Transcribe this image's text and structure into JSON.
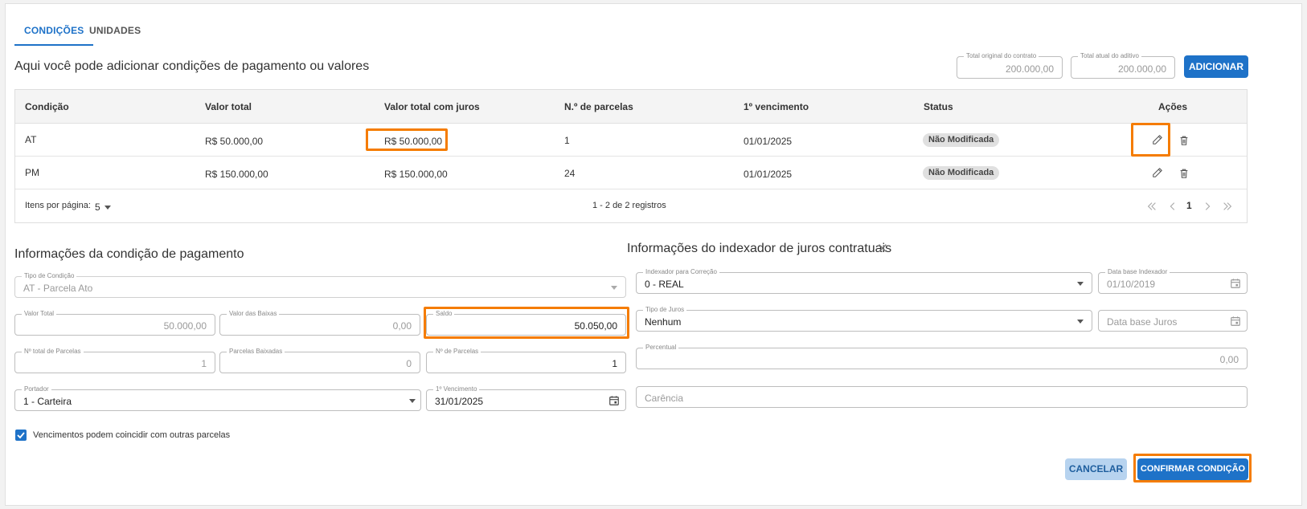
{
  "tabs": [
    {
      "label": "CONDIÇÕES",
      "active": true
    },
    {
      "label": "UNIDADES",
      "active": false
    }
  ],
  "header": {
    "title": "Aqui você pode adicionar condições de pagamento ou valores",
    "total_original": {
      "label": "Total original do contrato",
      "value": "200.000,00"
    },
    "total_atual": {
      "label": "Total atual do aditivo",
      "value": "200.000,00"
    },
    "add_button": "ADICIONAR"
  },
  "table": {
    "columns": [
      "Condição",
      "Valor total",
      "Valor total com juros",
      "N.º de parcelas",
      "1º vencimento",
      "Status",
      "Ações"
    ],
    "rows": [
      {
        "condicao": "AT",
        "valor_total": "R$ 50.000,00",
        "valor_juros": "R$ 50.000,00",
        "parcelas": "1",
        "vencimento": "01/01/2025",
        "status": "Não Modificada"
      },
      {
        "condicao": "PM",
        "valor_total": "R$ 150.000,00",
        "valor_juros": "R$ 150.000,00",
        "parcelas": "24",
        "vencimento": "01/01/2025",
        "status": "Não Modificada"
      }
    ],
    "footer": {
      "items_per_page_label": "Itens por página:",
      "items_per_page_value": "5",
      "range": "1 - 2 de 2 registros",
      "current_page": "1"
    }
  },
  "payment": {
    "title": "Informações da condição de pagamento",
    "tipo_condicao": {
      "label": "Tipo de Condição",
      "value": "AT - Parcela Ato"
    },
    "valor_total": {
      "label": "Valor Total",
      "value": "50.000,00"
    },
    "valor_baixas": {
      "label": "Valor das Baixas",
      "value": "0,00"
    },
    "saldo": {
      "label": "Saldo",
      "value": "50.050,00"
    },
    "total_parcelas": {
      "label": "Nº total de Parcelas",
      "value": "1"
    },
    "parcelas_baixadas": {
      "label": "Parcelas Baixadas",
      "value": "0"
    },
    "num_parcelas": {
      "label": "Nº de Parcelas",
      "value": "1"
    },
    "portador": {
      "label": "Portador",
      "value": "1 - Carteira"
    },
    "vencimento": {
      "label": "1º Vencimento",
      "value": "31/01/2025"
    },
    "checkbox_label": "Vencimentos podem coincidir com outras parcelas"
  },
  "indexer": {
    "title": "Informações do indexador de juros contratuais",
    "indexador": {
      "label": "Indexador para Correção",
      "value": "0 - REAL"
    },
    "data_base_indexador": {
      "label": "Data base Indexador",
      "value": "01/10/2019"
    },
    "tipo_juros": {
      "label": "Tipo de Juros",
      "value": "Nenhum"
    },
    "data_base_juros": {
      "placeholder": "Data base Juros"
    },
    "percentual": {
      "label": "Percentual",
      "value": "0,00"
    },
    "carencia": {
      "placeholder": "Carência"
    }
  },
  "actions": {
    "cancel": "CANCELAR",
    "confirm": "CONFIRMAR CONDIÇÃO"
  },
  "colors": {
    "primary": "#1e72c8",
    "highlight": "#f57c00",
    "badge": "#e0e0e0"
  }
}
